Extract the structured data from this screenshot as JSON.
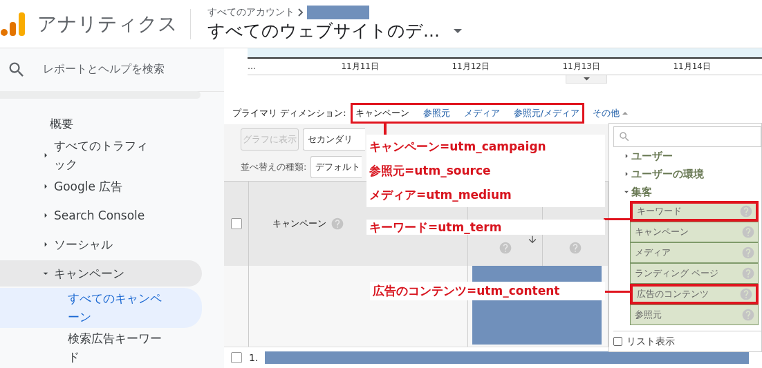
{
  "header": {
    "product": "アナリティクス",
    "breadcrumb": "すべてのアカウント",
    "view_title": "すべてのウェブサイトのデ..."
  },
  "sidebar": {
    "search": {
      "placeholder": "レポートとヘルプを検索"
    },
    "items": [
      {
        "label": "概要",
        "selected": false
      },
      {
        "label": "すべてのトラフィック",
        "selected": false,
        "expanded": false
      },
      {
        "label": "Google 広告",
        "selected": false,
        "expanded": false
      },
      {
        "label": "Search Console",
        "selected": false,
        "expanded": false
      },
      {
        "label": "ソーシャル",
        "selected": false,
        "expanded": false
      },
      {
        "label": "キャンペーン",
        "selected": false,
        "expanded": true,
        "children": [
          {
            "label": "すべてのキャンペーン",
            "selected": true
          },
          {
            "label": "検索広告キーワード",
            "selected": false
          }
        ]
      }
    ]
  },
  "chart": {
    "axis_labels": [
      "…",
      "11月11日",
      "11月12日",
      "11月13日",
      "11月14日"
    ]
  },
  "primary_dimension": {
    "label": "プライマリ ディメンション:",
    "options": [
      {
        "label": "キャンペーン",
        "selected": true
      },
      {
        "label": "参照元",
        "selected": false
      },
      {
        "label": "メディア",
        "selected": false
      },
      {
        "label": "参照元/メディア",
        "selected": false
      }
    ],
    "more": "その他"
  },
  "toolbar": {
    "chart_button": {
      "label": "グラフに表示",
      "disabled": true
    },
    "secondary": "セカンダリ",
    "sort_label": "並べ替えの種類:",
    "sort_value": "デフォルト"
  },
  "table": {
    "select_all": {
      "checked": false
    },
    "columns": [
      {
        "label": "キャンペーン"
      }
    ],
    "rows": [
      {
        "index": "1.",
        "checked": false
      }
    ]
  },
  "dimension_menu": {
    "groups": [
      {
        "label": "ユーザー",
        "expanded": false
      },
      {
        "label": "ユーザーの環境",
        "expanded": false
      },
      {
        "label": "集客",
        "expanded": true,
        "children": [
          {
            "label": "キーワード",
            "highlighted": true
          },
          {
            "label": "キャンペーン",
            "highlighted": false
          },
          {
            "label": "メディア",
            "highlighted": false
          },
          {
            "label": "ランディング ページ",
            "highlighted": false
          },
          {
            "label": "広告のコンテンツ",
            "highlighted": true
          },
          {
            "label": "参照元",
            "highlighted": false
          }
        ]
      }
    ],
    "list_view": {
      "label": "リスト表示",
      "checked": false
    }
  },
  "annotations": [
    {
      "lines": [
        "キャンペーン=utm_campaign",
        "参照元=utm_source",
        "メディア=utm_medium"
      ]
    },
    {
      "lines": [
        "キーワード=utm_term"
      ]
    },
    {
      "lines": [
        "広告のコンテンツ=utm_content"
      ]
    }
  ]
}
